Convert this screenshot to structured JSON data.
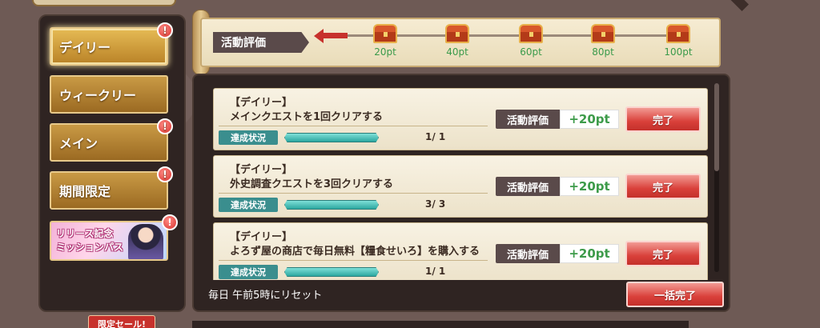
{
  "sidebar": {
    "items": [
      {
        "label": "デイリー",
        "badge": "!"
      },
      {
        "label": "ウィークリー",
        "badge": ""
      },
      {
        "label": "メイン",
        "badge": "!"
      },
      {
        "label": "期間限定",
        "badge": "!"
      }
    ],
    "pass_banner": {
      "line1": "リリース記念",
      "line2": "ミッションパス",
      "badge": "!"
    }
  },
  "progress": {
    "label": "活動評価",
    "current_points": 0,
    "milestones": [
      "20pt",
      "40pt",
      "60pt",
      "80pt",
      "100pt"
    ]
  },
  "missions": [
    {
      "category": "【デイリー】",
      "title": "メインクエストを1回クリアする",
      "status_label": "達成状況",
      "progress": 1.0,
      "count": "1/ 1",
      "reward_label": "活動評価",
      "reward": "+20pt",
      "button": "完了"
    },
    {
      "category": "【デイリー】",
      "title": "外史調査クエストを3回クリアする",
      "status_label": "達成状況",
      "progress": 1.0,
      "count": "3/ 3",
      "reward_label": "活動評価",
      "reward": "+20pt",
      "button": "完了"
    },
    {
      "category": "【デイリー】",
      "title": "よろず屋の商店で毎日無料【糧食せいろ】を購入する",
      "status_label": "達成状況",
      "progress": 1.0,
      "count": "1/ 1",
      "reward_label": "活動評価",
      "reward": "+20pt",
      "button": "完了"
    }
  ],
  "footer": {
    "reset_text": "毎日 午前5時にリセット",
    "bulk_button": "一括完了"
  },
  "bottom": {
    "sale_tab": "限定セール!"
  },
  "colors": {
    "accent_gold": "#c99a45",
    "complete_red": "#d9403a",
    "reward_green": "#3d9b4a",
    "status_teal": "#3a8e8e"
  }
}
